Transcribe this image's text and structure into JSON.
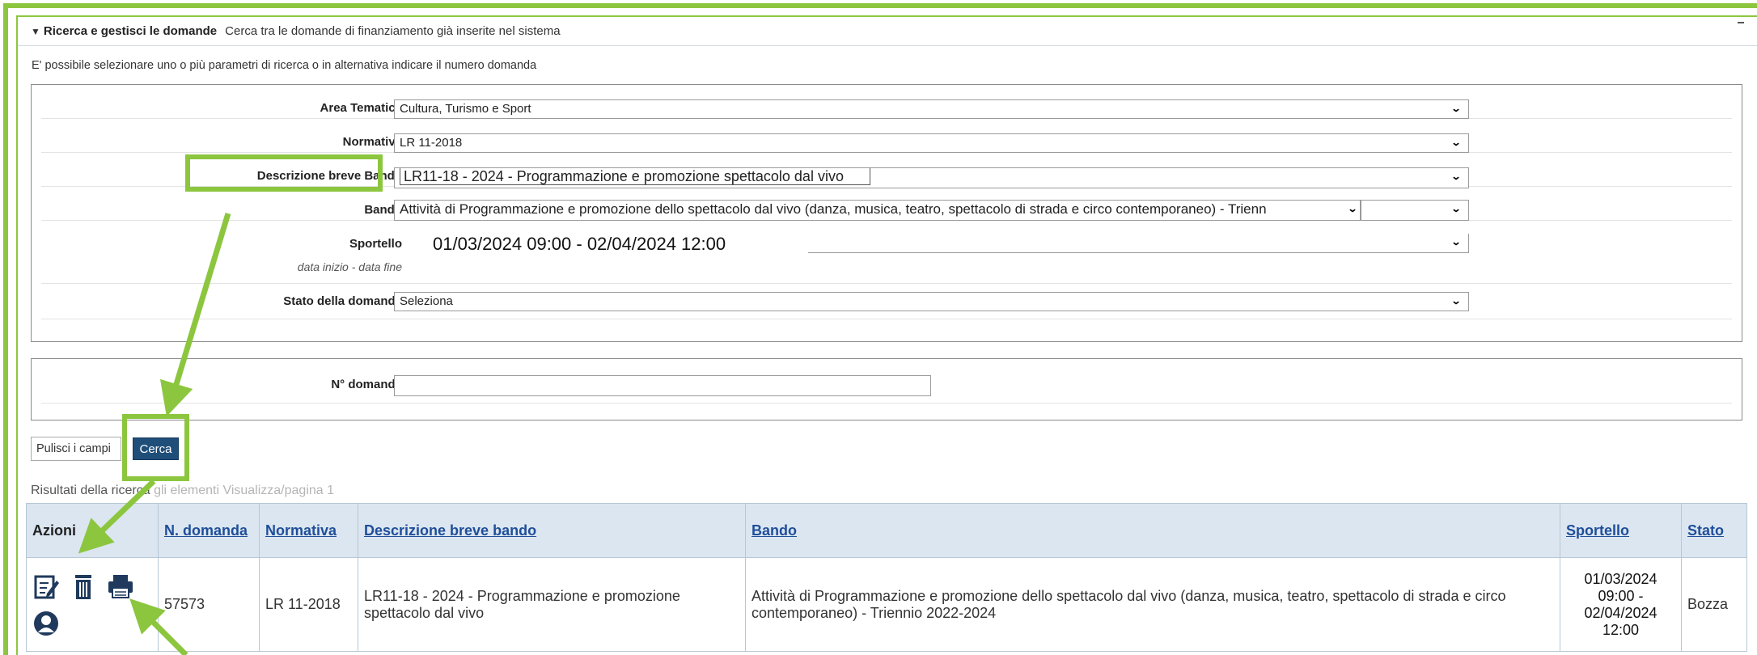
{
  "panel": {
    "title": "Ricerca e gestisci le domande",
    "subtitle": "Cerca tra le domande di finanziamento già inserite nel sistema",
    "intro": "E' possibile selezionare uno o più parametri di ricerca o in alternativa indicare il numero domanda"
  },
  "filters": {
    "area_label": "Area Tematica",
    "area_value": "Cultura, Turismo e Sport",
    "normativa_label": "Normativa",
    "normativa_value": "LR 11-2018",
    "descr_label": "Descrizione breve Bando",
    "descr_value": "LR11-18 - 2024 - Programmazione e promozione spettacolo dal vivo",
    "bando_label": "Bando",
    "bando_value": "Attività di Programmazione e promozione dello spettacolo dal vivo (danza, musica, teatro, spettacolo di strada e circo contemporaneo) - Trienn",
    "sportello_label": "Sportello",
    "sportello_sub": "data inizio - data fine",
    "sportello_value": "01/03/2024 09:00 - 02/04/2024 12:00",
    "stato_label": "Stato della domanda",
    "stato_value": "Seleziona",
    "num_label": "N° domanda",
    "num_value": ""
  },
  "buttons": {
    "clear": "Pulisci i campi",
    "search": "Cerca"
  },
  "results": {
    "caption": "Risultati della ricerca",
    "caption_ghost": "gli elementi Visualizza/pagina 1",
    "headers": [
      "Azioni",
      "N. domanda",
      "Normativa",
      "Descrizione breve bando",
      "Bando",
      "Sportello",
      "Stato"
    ],
    "row": {
      "numero": "57573",
      "normativa": "LR 11-2018",
      "descrizione": "LR11-18 - 2024 - Programmazione e promozione spettacolo dal vivo",
      "bando": "Attività di Programmazione e promozione dello spettacolo dal vivo (danza, musica, teatro, spettacolo di strada e circo contemporaneo) - Triennio 2022-2024",
      "sportello": "01/03/2024 09:00 - 02/04/2024 12:00",
      "stato": "Bozza"
    },
    "action_icons": [
      "edit-icon",
      "trash-icon",
      "print-icon",
      "user-icon"
    ]
  },
  "colors": {
    "annotation_green": "#8cc63f",
    "header_bg": "#dbe6f0",
    "button_blue": "#1f4e79",
    "link_blue": "#1f4e9a"
  }
}
